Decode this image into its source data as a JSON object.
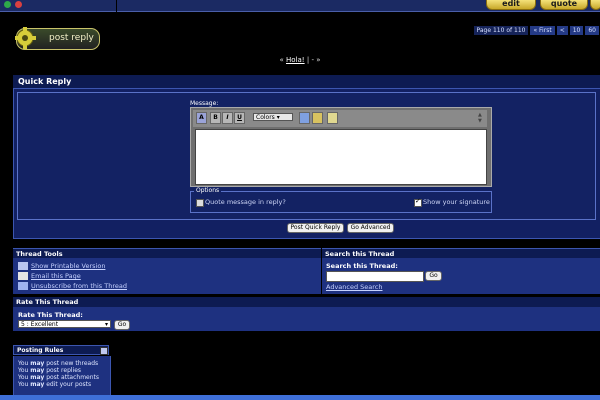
{
  "topbar": {
    "buttons": [
      "edit",
      "quote"
    ]
  },
  "post_reply": {
    "label": "post reply"
  },
  "pagination": {
    "label": "Page 110 of 110",
    "first": "« First",
    "prev": "<",
    "pages": [
      "10",
      "60"
    ]
  },
  "hola_line": {
    "prefix": "«",
    "link": "Hola!",
    "separator": "|",
    "dash": "-",
    "suffix": "»"
  },
  "quick_reply": {
    "title": "Quick Reply",
    "message_label": "Message:",
    "colors_label": "Colors",
    "toolbar": {
      "bold": "B",
      "italic": "I",
      "underline": "U"
    },
    "options_legend": "Options",
    "quote_option": "Quote message in reply?",
    "signature_option": "Show your signature",
    "post_button": "Post Quick Reply",
    "advanced_button": "Go Advanced"
  },
  "thread_tools": {
    "title": "Thread Tools",
    "links": [
      "Show Printable Version",
      "Email this Page",
      "Unsubscribe from this Thread"
    ]
  },
  "search_thread": {
    "title": "Search this Thread",
    "label": "Search this Thread:",
    "go": "Go",
    "advanced": "Advanced Search"
  },
  "rate_thread": {
    "title": "Rate This Thread",
    "label": "Rate This Thread:",
    "selected": "5 : Excellent",
    "go": "Go"
  },
  "posting_rules": {
    "title": "Posting Rules",
    "lines": [
      {
        "pre": "You ",
        "bold": "may",
        "post": " post new threads"
      },
      {
        "pre": "You ",
        "bold": "may",
        "post": " post replies"
      },
      {
        "pre": "You ",
        "bold": "may",
        "post": " post attachments"
      },
      {
        "pre": "You ",
        "bold": "may",
        "post": " edit your posts"
      }
    ]
  },
  "colors": {
    "panel": "#122062",
    "header": "#0d1b52",
    "accent": "#c9c36a"
  }
}
